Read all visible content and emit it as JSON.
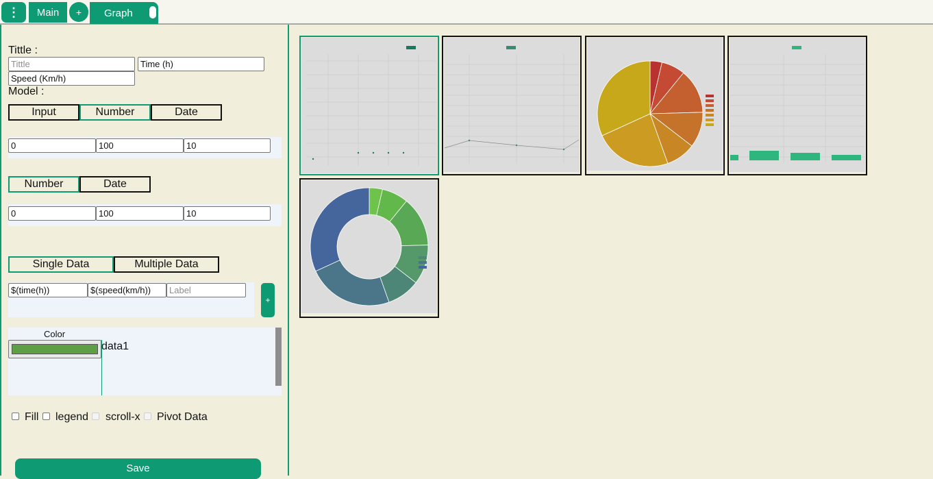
{
  "tabs": {
    "menu_icon": "⋮",
    "main_label": "Main",
    "add_label": "+",
    "graph_label": "Graph"
  },
  "form": {
    "title_label": "Tittle :",
    "title_placeholder": "Tittle",
    "x_label_value": "Time (h)",
    "y_label_value": "Speed (Km/h)",
    "model_label": "Model :",
    "x_axis_modes": [
      "Input",
      "Number",
      "Date"
    ],
    "x_axis_range": {
      "min": "0",
      "max": "100",
      "step": "10"
    },
    "y_axis_modes": [
      "Number",
      "Date"
    ],
    "y_axis_range": {
      "min": "0",
      "max": "100",
      "step": "10"
    },
    "data_modes": [
      "Single Data",
      "Multiple Data"
    ],
    "series_x": "$(time(h))",
    "series_y": "$(speed(km/h))",
    "series_label_placeholder": "Label",
    "add_series": "+",
    "color_header": "Color",
    "series_name": "data1",
    "series_color": "#5e9e45",
    "options": {
      "fill": "Fill",
      "legend": "legend",
      "scroll_x": "scroll-x",
      "pivot": "Pivot Data"
    },
    "save_label": "Save"
  },
  "colors": {
    "accent": "#0e9a73",
    "background": "#f1efdc"
  },
  "thumbnails": [
    {
      "type": "scatter",
      "selected": true
    },
    {
      "type": "line"
    },
    {
      "type": "pie",
      "colors": [
        "#b8332f",
        "#c44a33",
        "#c45f2f",
        "#c5722a",
        "#c88625",
        "#cc9c22",
        "#c7a81b"
      ],
      "values": [
        4,
        8,
        15,
        12,
        10,
        26,
        35
      ]
    },
    {
      "type": "bar",
      "values": [
        8,
        12,
        10,
        8
      ]
    },
    {
      "type": "doughnut",
      "colors": [
        "#6ec34a",
        "#62b84a",
        "#59a856",
        "#55996a",
        "#4d8577",
        "#4b7588",
        "#44669d"
      ],
      "values": [
        4,
        8,
        15,
        12,
        10,
        26,
        35
      ]
    }
  ]
}
